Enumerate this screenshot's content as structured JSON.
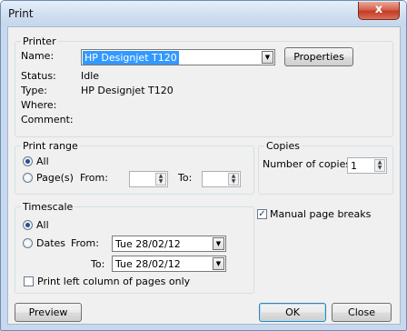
{
  "window": {
    "title": "Print",
    "close_glyph": "x"
  },
  "printer": {
    "group_title": "Printer",
    "name_label": "Name:",
    "name_value": "HP Designjet T120",
    "properties_button": "Properties",
    "status_label": "Status:",
    "status_value": "Idle",
    "type_label": "Type:",
    "type_value": "HP Designjet T120",
    "where_label": "Where:",
    "where_value": "",
    "comment_label": "Comment:",
    "comment_value": ""
  },
  "print_range": {
    "group_title": "Print range",
    "all_label": "All",
    "all_selected": true,
    "pages_label": "Page(s)",
    "from_label": "From:",
    "from_value": "",
    "to_label": "To:",
    "to_value": ""
  },
  "copies": {
    "group_title": "Copies",
    "number_label": "Number of copies:",
    "number_value": "1"
  },
  "timescale": {
    "group_title": "Timescale",
    "all_label": "All",
    "all_selected": true,
    "dates_label": "Dates",
    "from_label": "From:",
    "from_value": "Tue 28/02/12",
    "to_label": "To:",
    "to_value": "Tue 28/02/12",
    "left_column_label": "Print left column of pages only",
    "left_column_checked": false
  },
  "manual_breaks": {
    "label": "Manual page breaks",
    "checked": true
  },
  "footer": {
    "preview_button": "Preview",
    "ok_button": "OK",
    "close_button": "Close"
  },
  "colors": {
    "selection": "#3399ff",
    "window_frame": "#c7d9ee",
    "close_button": "#c43b25"
  }
}
